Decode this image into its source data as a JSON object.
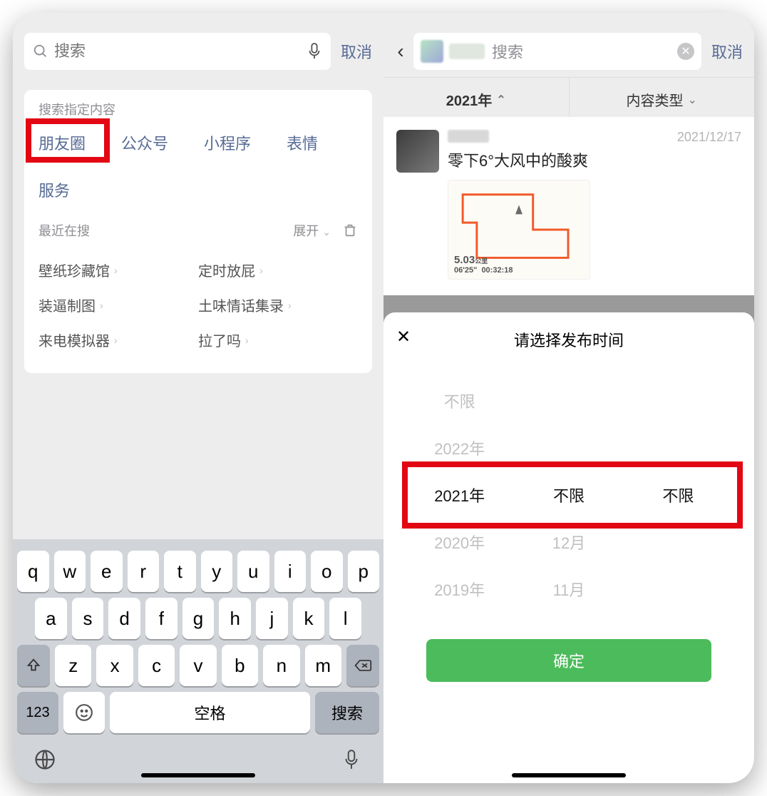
{
  "left": {
    "search_placeholder": "搜索",
    "cancel": "取消",
    "section_title": "搜索指定内容",
    "cats": {
      "moments": "朋友圈",
      "official": "公众号",
      "miniapp": "小程序",
      "sticker": "表情",
      "service": "服务"
    },
    "recent_title": "最近在搜",
    "expand": "展开",
    "recent": [
      "壁纸珍藏馆",
      "定时放屁",
      "装逼制图",
      "土味情话集录",
      "来电模拟器",
      "拉了吗"
    ],
    "keyboard": {
      "row1": [
        "q",
        "w",
        "e",
        "r",
        "t",
        "y",
        "u",
        "i",
        "o",
        "p"
      ],
      "row2": [
        "a",
        "s",
        "d",
        "f",
        "g",
        "h",
        "j",
        "k",
        "l"
      ],
      "row3": [
        "z",
        "x",
        "c",
        "v",
        "b",
        "n",
        "m"
      ],
      "num": "123",
      "space": "空格",
      "search": "搜索"
    }
  },
  "right": {
    "search_placeholder": "搜索",
    "cancel": "取消",
    "filter_year": "2021年",
    "filter_type": "内容类型",
    "feed": {
      "date": "2021/12/17",
      "text": "零下6°大风中的酸爽",
      "map_stat1": "5.03",
      "map_stat2": "06'25\"",
      "map_stat3": "00:32:18"
    },
    "sheet": {
      "title": "请选择发布时间",
      "col1": [
        "不限",
        "2022年",
        "2021年",
        "2020年",
        "2019年"
      ],
      "col2": [
        "",
        "",
        "不限",
        "12月",
        "11月"
      ],
      "col3": [
        "",
        "",
        "不限",
        "",
        ""
      ],
      "confirm": "确定"
    }
  }
}
